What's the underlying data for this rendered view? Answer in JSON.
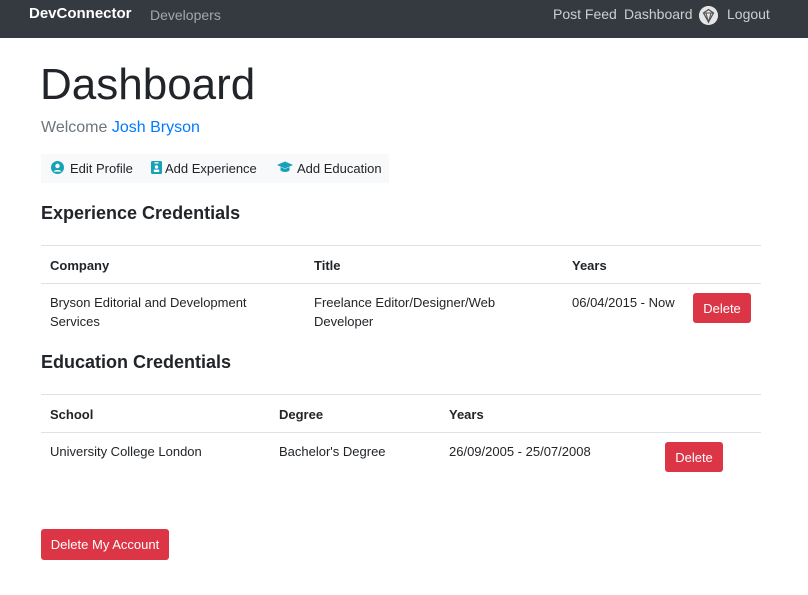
{
  "nav": {
    "brand": "DevConnector",
    "developers": "Developers",
    "post_feed": "Post Feed",
    "dashboard": "Dashboard",
    "logout": "Logout"
  },
  "header": {
    "title": "Dashboard",
    "welcome_prefix": "Welcome ",
    "user_name": "Josh Bryson"
  },
  "actions": {
    "edit_profile": "Edit Profile",
    "add_experience": "Add Experience",
    "add_education": "Add Education"
  },
  "experience": {
    "title": "Experience Credentials",
    "headers": [
      "Company",
      "Title",
      "Years"
    ],
    "rows": [
      {
        "company_line1": "Bryson Editorial and Development",
        "company_line2": "Services",
        "title_line1": "Freelance Editor/Designer/Web",
        "title_line2": "Developer",
        "years": "06/04/2015 - Now",
        "delete_label": "Delete"
      }
    ]
  },
  "education": {
    "title": "Education Credentials",
    "headers": [
      "School",
      "Degree",
      "Years"
    ],
    "rows": [
      {
        "school": "University College London",
        "degree": "Bachelor's Degree",
        "years": "26/09/2005 - 25/07/2008",
        "delete_label": "Delete"
      }
    ]
  },
  "delete_account_label": "Delete My Account",
  "colors": {
    "navbar": "#343a40",
    "link": "#007bff",
    "danger": "#dc3545",
    "icon": "#17a2b8"
  }
}
